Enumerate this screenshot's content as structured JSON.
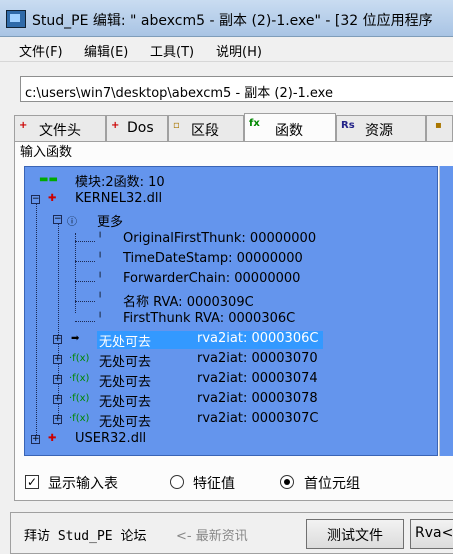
{
  "window": {
    "title": "Stud_PE 编辑: \"    abexcm5 - 副本 (2)-1.exe\" - [32 位应用程序"
  },
  "menu": [
    "文件(F)",
    "编辑(E)",
    "工具(T)",
    "说明(H)"
  ],
  "path": "c:\\users\\win7\\desktop\\abexcm5 - 副本 (2)-1.exe",
  "tabs": [
    {
      "label": "文件头",
      "icon": "+"
    },
    {
      "label": "Dos",
      "icon": "+"
    },
    {
      "label": "区段",
      "icon": "▫"
    },
    {
      "label": "函数",
      "icon": "fx"
    },
    {
      "label": "资源",
      "icon": "Rs"
    }
  ],
  "group_label": "输入函数",
  "tree": {
    "root": "模块:2函数: 10",
    "kernel": "KERNEL32.dll",
    "more": "更多",
    "details": [
      "OriginalFirstThunk: 00000000",
      "TimeDateStamp: 00000000",
      "ForwarderChain: 00000000",
      "名称 RVA: 0000309C",
      "FirstThunk RVA: 0000306C"
    ],
    "funcs": [
      {
        "name": "无处可去",
        "iat": "rva2iat: 0000306C"
      },
      {
        "name": "无处可去",
        "iat": "rva2iat: 00003070"
      },
      {
        "name": "无处可去",
        "iat": "rva2iat: 00003074"
      },
      {
        "name": "无处可去",
        "iat": "rva2iat: 00003078"
      },
      {
        "name": "无处可去",
        "iat": "rva2iat: 0000307C"
      }
    ],
    "user": "USER32.dll"
  },
  "options": {
    "show_imports": "显示输入表",
    "features": "特征值",
    "first_tuple": "首位元组"
  },
  "footer": {
    "visit": "拜访 Stud_PE 论坛",
    "news": "<- 最新资讯",
    "test_file": "测试文件",
    "rva": "Rva<="
  }
}
